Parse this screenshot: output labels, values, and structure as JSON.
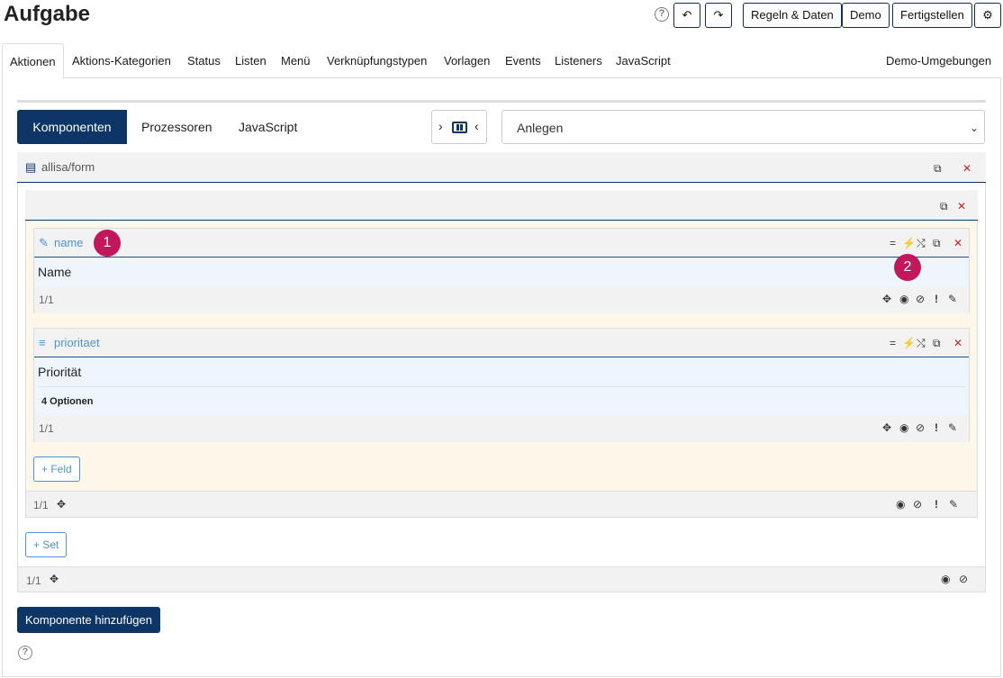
{
  "header": {
    "title": "Aufgabe",
    "help_icon": "?",
    "undo_icon": "↶",
    "redo_icon": "↷",
    "buttons": [
      "Regeln & Daten",
      "Demo",
      "Fertigstellen"
    ],
    "settings_icon": "⚙"
  },
  "tabs": [
    "Aktionen",
    "Aktions-Kategorien",
    "Status",
    "Listen",
    "Menü",
    "Verknüpfungstypen",
    "Vorlagen",
    "Events",
    "Listeners",
    "JavaScript"
  ],
  "tab_right": "Demo-Umgebungen",
  "subtabs": [
    "Komponenten",
    "Prozessoren",
    "JavaScript"
  ],
  "toggle": {
    "left": "›",
    "right": "‹"
  },
  "select_value": "Anlegen",
  "select_chevron": "⌄",
  "component": {
    "name": "allisa/form",
    "footer": "1/1",
    "set_footer": "1/1",
    "add_field": "+ Feld",
    "add_set": "+ Set",
    "fields": [
      {
        "key": "name",
        "label": "Name",
        "footer": "1/1"
      },
      {
        "key": "prioritaet",
        "label": "Priorität",
        "options": "4 Optionen",
        "footer": "1/1"
      }
    ]
  },
  "badges": [
    "1",
    "2"
  ],
  "icons": {
    "copy": "⧉",
    "close": "✕",
    "equals": "=",
    "bolt": "⚡",
    "shuffle": "⤭",
    "move": "✥",
    "eye": "◉",
    "eye_off": "⊘",
    "excl": "!",
    "pen": "✎",
    "pencil": "✎",
    "list": "≡",
    "file": "▤"
  },
  "add_component": "Komponente hinzufügen",
  "help_bottom": "?"
}
